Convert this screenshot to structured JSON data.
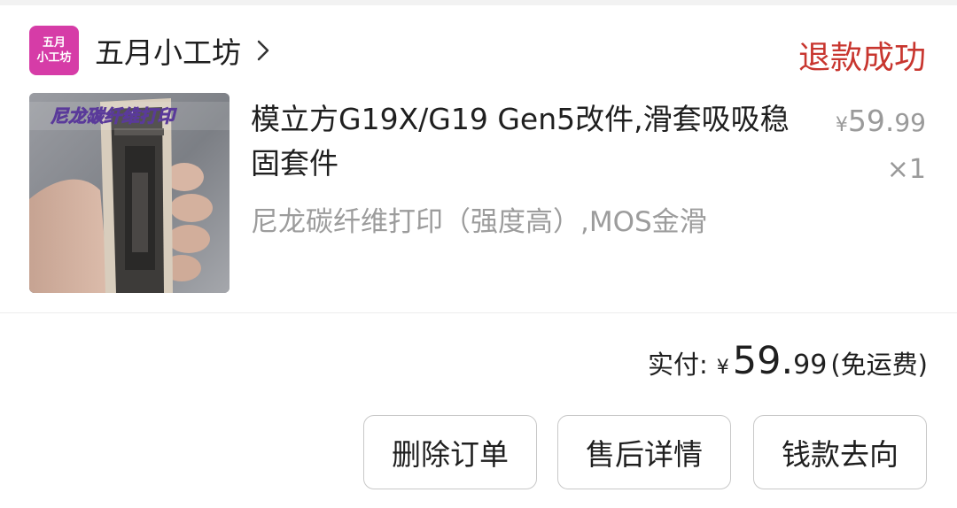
{
  "shop": {
    "logo_line1": "五月",
    "logo_line2": "小工坊",
    "name": "五月小工坊",
    "chevron_icon": "chevron-right-icon"
  },
  "order": {
    "status": "退款成功",
    "status_color": "#c8362f"
  },
  "product": {
    "thumbnail_caption": "尼龙碳纤维打印",
    "title": "模立方G19X/G19 Gen5改件,滑套吸吸稳固套件",
    "spec": "尼龙碳纤维打印（强度高）,MOS金滑",
    "price_symbol": "¥",
    "price_int": "59.",
    "price_dec": "99",
    "quantity": "×1"
  },
  "payment": {
    "label": "实付:",
    "symbol": "¥",
    "amount_int": "59.",
    "amount_dec": "99",
    "note": "(免运费)"
  },
  "actions": {
    "delete_label": "删除订单",
    "after_sales_label": "售后详情",
    "refund_trace_label": "钱款去向"
  }
}
